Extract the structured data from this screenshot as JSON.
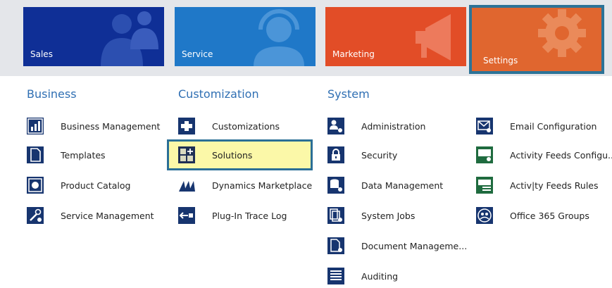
{
  "tiles": {
    "sales": "Sales",
    "service": "Service",
    "marketing": "Marketing",
    "settings": "Settings"
  },
  "columns": {
    "business": {
      "heading": "Business",
      "items": [
        "Business Management",
        "Templates",
        "Product Catalog",
        "Service Management"
      ]
    },
    "customization": {
      "heading": "Customization",
      "items": [
        "Customizations",
        "Solutions",
        "Dynamics Marketplace",
        "Plug-In Trace Log"
      ]
    },
    "system": {
      "heading": "System",
      "items": [
        "Administration",
        "Security",
        "Data Management",
        "System Jobs",
        "Document Manageme...",
        "Auditing"
      ]
    },
    "system2": {
      "items": [
        "Email Configuration",
        "Activity Feeds Configu...",
        "Activ|ty Feeds Rules",
        "Office 365 Groups"
      ]
    }
  },
  "colors": {
    "sales": "#0f2f96",
    "service": "#1f78c8",
    "marketing": "#e24d27",
    "settings": "#e0662f",
    "heading": "#2f6fb3",
    "highlight": "#fbf8a8",
    "outline": "#2b6f96"
  },
  "icons": {
    "business": [
      "chart-icon",
      "document-icon",
      "catalog-icon",
      "wrench-gear-icon"
    ],
    "customization": [
      "puzzle-icon",
      "solutions-icon",
      "marketplace-icon",
      "plugin-trace-icon"
    ],
    "system": [
      "users-gear-icon",
      "lock-icon",
      "database-gear-icon",
      "jobs-gear-icon",
      "document-gear-icon",
      "list-icon"
    ],
    "system2": [
      "email-gear-icon",
      "feed-config-icon",
      "feed-rules-icon",
      "groups-icon"
    ]
  }
}
